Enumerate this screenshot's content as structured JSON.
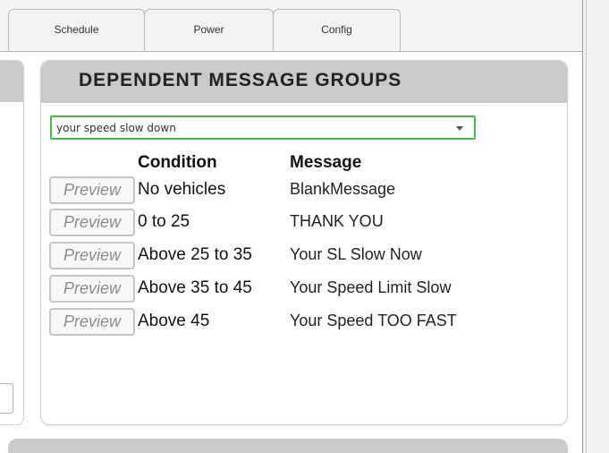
{
  "tabs": [
    {
      "label": "Schedule"
    },
    {
      "label": "Power"
    },
    {
      "label": "Config"
    }
  ],
  "panel": {
    "title": "DEPENDENT MESSAGE GROUPS",
    "select": {
      "value": "your speed slow down"
    },
    "columns": {
      "condition": "Condition",
      "message": "Message"
    },
    "rows": [
      {
        "button": "Preview",
        "condition": "No vehicles",
        "message": "BlankMessage"
      },
      {
        "button": "Preview",
        "condition": "0 to 25",
        "message": "THANK YOU"
      },
      {
        "button": "Preview",
        "condition": "Above 25 to 35",
        "message": "Your SL Slow Now"
      },
      {
        "button": "Preview",
        "condition": "Above 35 to 45",
        "message": "Your Speed Limit Slow"
      },
      {
        "button": "Preview",
        "condition": "Above 45",
        "message": "Your Speed TOO FAST"
      }
    ]
  },
  "colors": {
    "panel_header": "#c9c9c9",
    "select_border": "#4cb84c",
    "preview_text": "#8c8c8c"
  }
}
